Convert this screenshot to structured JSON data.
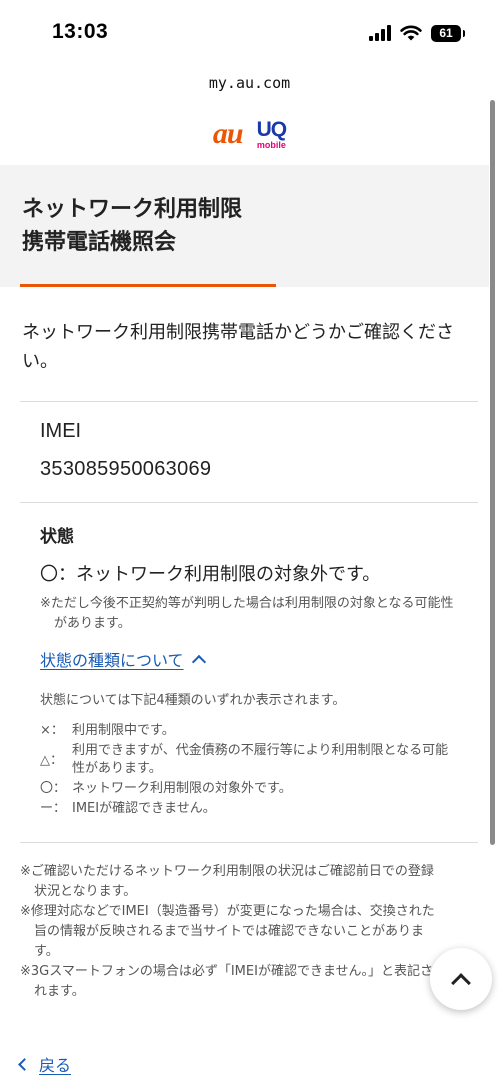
{
  "status_bar": {
    "time": "13:03",
    "battery": "61"
  },
  "browser": {
    "url": "my.au.com"
  },
  "brand": {
    "au": "au",
    "uq": "UQ",
    "uq_sub": "mobile",
    "au_color": "#eb5505",
    "uq_color": "#1a3aa8"
  },
  "page": {
    "title": "ネットワーク利用制限\n携帯電話機照会",
    "intro": "ネットワーク利用制限携帯電話かどうかご確認ください。"
  },
  "imei": {
    "label": "IMEI",
    "value": "353085950063069"
  },
  "state": {
    "label": "状態",
    "value": "〇：ネットワーク利用制限の対象外です。",
    "note": "※ただし今後不正契約等が判明した場合は利用制限の対象となる可能性があります。"
  },
  "types": {
    "link": "状態の種類について",
    "description": "状態については下記4種類のいずれか表示されます。",
    "items": [
      {
        "symbol": "×：",
        "text": "利用制限中です。"
      },
      {
        "symbol": "△：",
        "text": "利用できますが、代金債務の不履行等により利用制限となる可能性があります。"
      },
      {
        "symbol": "〇：",
        "text": "ネットワーク利用制限の対象外です。"
      },
      {
        "symbol": "ー：",
        "text": "IMEIが確認できません。"
      }
    ]
  },
  "footnotes": [
    "※ご確認いただけるネットワーク利用制限の状況はご確認前日での登録状況となります。",
    "※修理対応などでIMEI（製造番号）が変更になった場合は、交換された旨の情報が反映されるまで当サイトでは確認できないことがあります。",
    "※3Gスマートフォンの場合は必ず「IMEIが確認できません。」と表記されます。"
  ],
  "nav": {
    "back": "戻る"
  },
  "colors": {
    "accent": "#eb5505",
    "link": "#1a5bb5"
  }
}
